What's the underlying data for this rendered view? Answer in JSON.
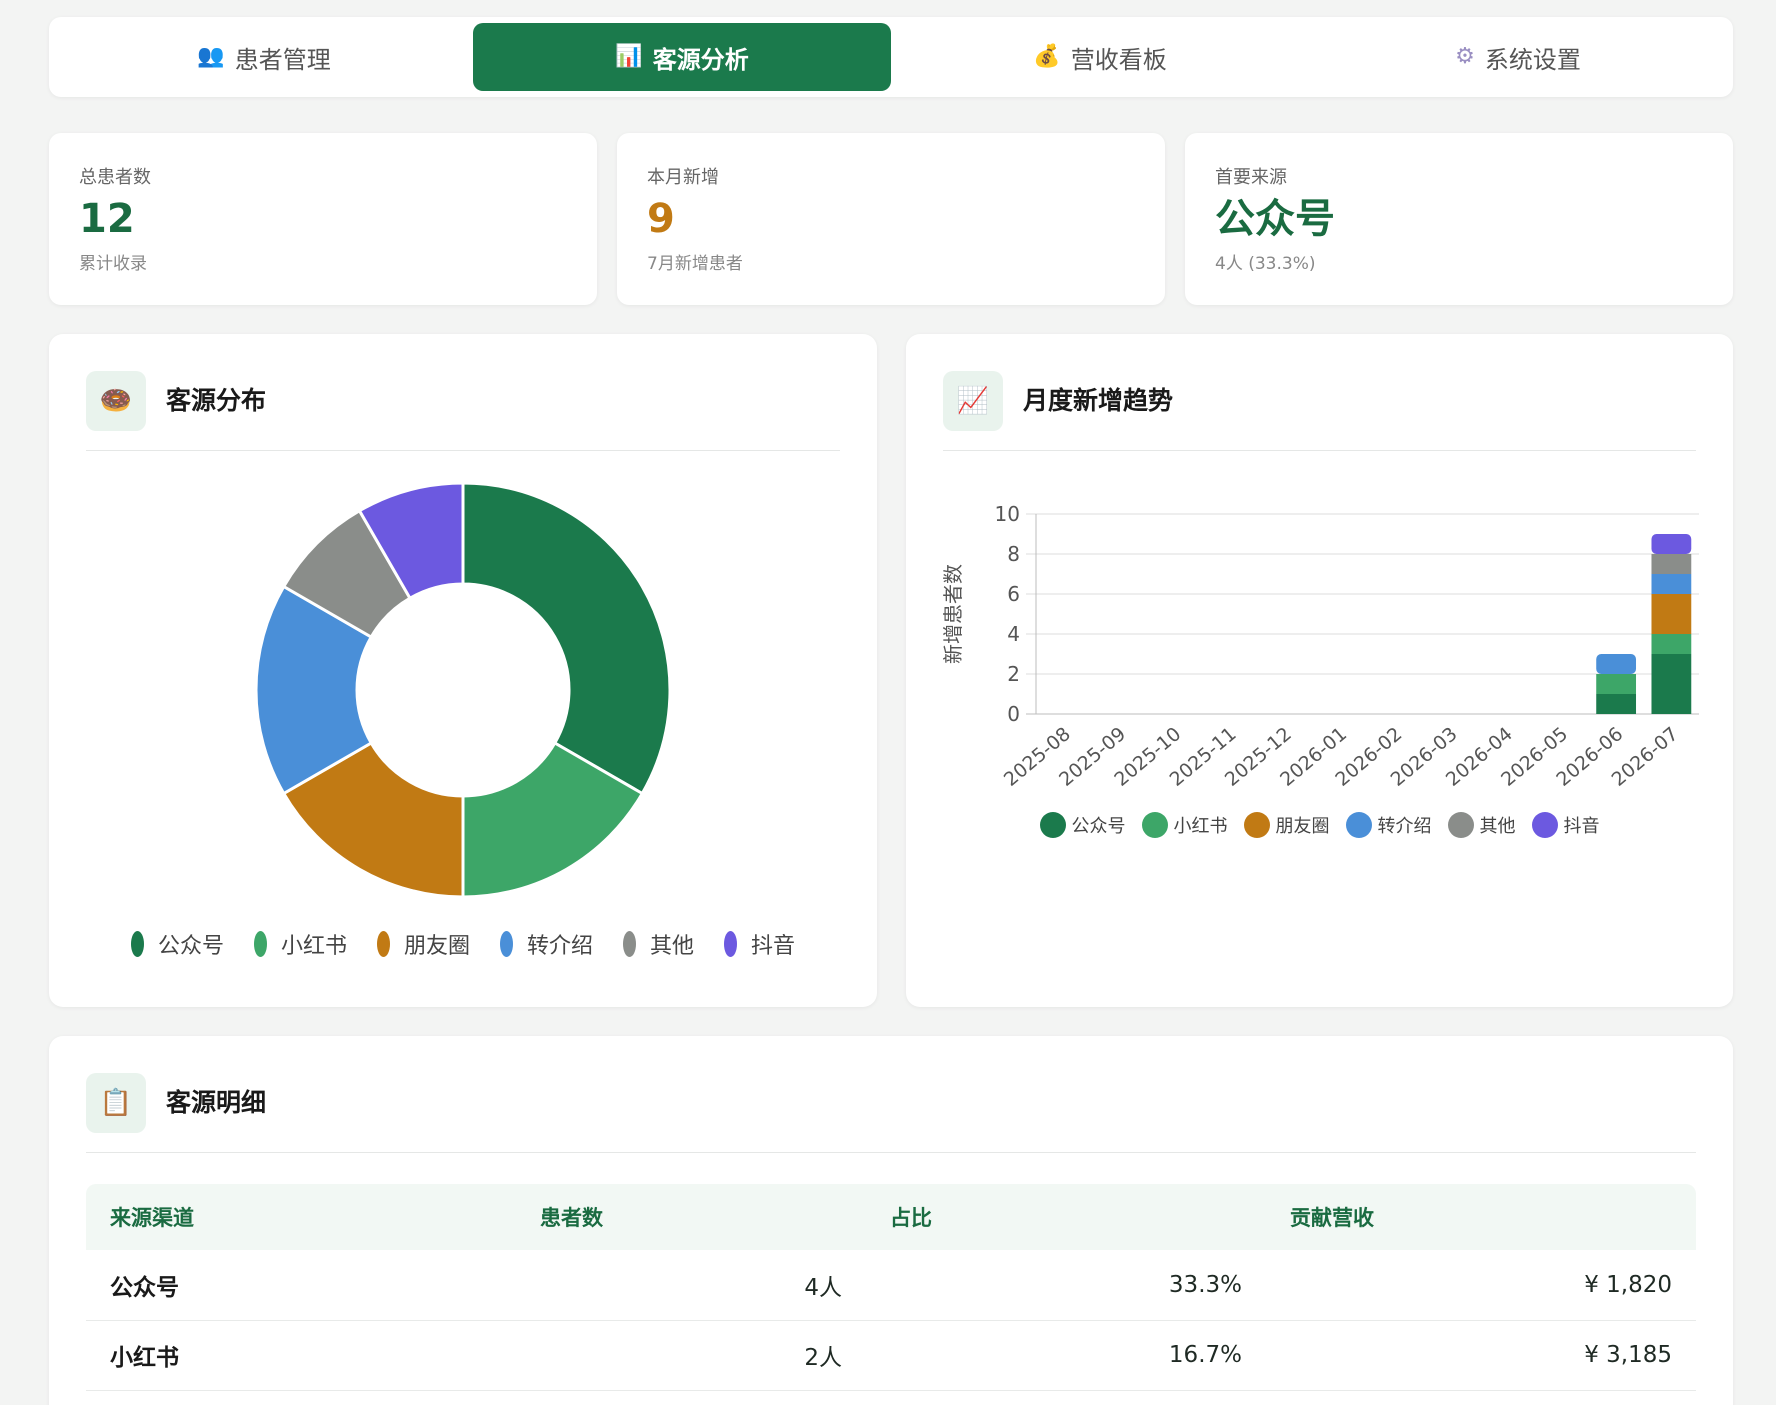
{
  "nav": {
    "tabs": [
      {
        "label": "患者管理",
        "icon": "people-icon",
        "active": false
      },
      {
        "label": "客源分析",
        "icon": "bar-chart-icon",
        "active": true
      },
      {
        "label": "营收看板",
        "icon": "money-bag-icon",
        "active": false
      },
      {
        "label": "系统设置",
        "icon": "gear-icon",
        "active": false
      }
    ]
  },
  "stats": [
    {
      "label": "总患者数",
      "value": "12",
      "sub": "累计收录",
      "color": "#1a6b41"
    },
    {
      "label": "本月新增",
      "value": "9",
      "sub": "7月新增患者",
      "color": "#c17a14"
    },
    {
      "label": "首要来源",
      "value": "公众号",
      "sub": "4人 (33.3%)",
      "color": "#1a6b41"
    }
  ],
  "panels": {
    "distribution": {
      "title": "客源分布",
      "icon": "donut-icon"
    },
    "trend": {
      "title": "月度新增趋势",
      "icon": "line-chart-icon"
    },
    "detail": {
      "title": "客源明细",
      "icon": "clipboard-icon"
    }
  },
  "colors": {
    "公众号": "#1b7a4c",
    "小红书": "#3da668",
    "朋友圈": "#c17a14",
    "转介绍": "#4a8fd8",
    "其他": "#8a8d8a",
    "抖音": "#6c59e0"
  },
  "chart_data": [
    {
      "type": "pie",
      "labels": [
        "公众号",
        "小红书",
        "朋友圈",
        "转介绍",
        "其他",
        "抖音"
      ],
      "values": [
        4,
        2,
        2,
        2,
        1,
        1
      ],
      "legend": "bottom"
    },
    {
      "type": "bar",
      "stacked": true,
      "categories": [
        "2025-08",
        "2025-09",
        "2025-10",
        "2025-11",
        "2025-12",
        "2026-01",
        "2026-02",
        "2026-03",
        "2026-04",
        "2026-05",
        "2026-06",
        "2026-07"
      ],
      "series": [
        {
          "name": "公众号",
          "values": [
            0,
            0,
            0,
            0,
            0,
            0,
            0,
            0,
            0,
            0,
            1,
            3
          ]
        },
        {
          "name": "小红书",
          "values": [
            0,
            0,
            0,
            0,
            0,
            0,
            0,
            0,
            0,
            0,
            1,
            1
          ]
        },
        {
          "name": "朋友圈",
          "values": [
            0,
            0,
            0,
            0,
            0,
            0,
            0,
            0,
            0,
            0,
            0,
            2
          ]
        },
        {
          "name": "转介绍",
          "values": [
            0,
            0,
            0,
            0,
            0,
            0,
            0,
            0,
            0,
            0,
            1,
            1
          ]
        },
        {
          "name": "其他",
          "values": [
            0,
            0,
            0,
            0,
            0,
            0,
            0,
            0,
            0,
            0,
            0,
            1
          ]
        },
        {
          "name": "抖音",
          "values": [
            0,
            0,
            0,
            0,
            0,
            0,
            0,
            0,
            0,
            0,
            0,
            1
          ]
        }
      ],
      "ylabel": "新增患者数",
      "ylim": [
        0,
        10
      ],
      "yticks": [
        0,
        2,
        4,
        6,
        8,
        10
      ],
      "grid": true,
      "legend": "bottom"
    }
  ],
  "table": {
    "headers": [
      "来源渠道",
      "患者数",
      "占比",
      "贡献营收"
    ],
    "rows": [
      {
        "source": "公众号",
        "count": "4人",
        "pct": "33.3%",
        "revenue": "¥ 1,820"
      },
      {
        "source": "小红书",
        "count": "2人",
        "pct": "16.7%",
        "revenue": "¥ 3,185"
      }
    ]
  }
}
